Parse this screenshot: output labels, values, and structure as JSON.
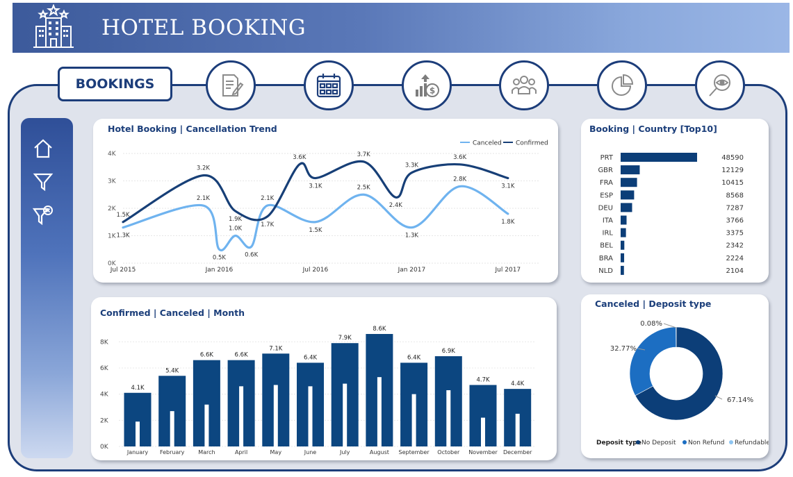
{
  "header": {
    "title": "HOTEL BOOKING"
  },
  "nav": {
    "active_tab": "BOOKINGS"
  },
  "trend": {
    "title": "Hotel Booking | Cancellation Trend",
    "legend": [
      {
        "label": "Canceled",
        "color": "#6fb3ef"
      },
      {
        "label": "Confirmed",
        "color": "#173f77"
      }
    ],
    "y_ticks": [
      "0K",
      "1K",
      "2K",
      "3K",
      "4K"
    ],
    "x_ticks": [
      "Jul 2015",
      "Jan 2016",
      "Jul 2016",
      "Jan 2017",
      "Jul 2017"
    ],
    "confirmed_labels": [
      "1.5K",
      "3.2K",
      "1.9K",
      "1.7K",
      "3.6K",
      "3.1K",
      "3.7K",
      "2.4K",
      "3.3K",
      "3.6K",
      "3.1K"
    ],
    "canceled_labels": [
      "1.3K",
      "2.1K",
      "0.5K",
      "1.0K",
      "0.6K",
      "2.1K",
      "1.5K",
      "2.5K",
      "1.3K",
      "2.8K",
      "1.8K"
    ]
  },
  "country": {
    "title": "Booking | Country [Top10]",
    "rows": [
      {
        "code": "PRT",
        "value": "48590"
      },
      {
        "code": "GBR",
        "value": "12129"
      },
      {
        "code": "FRA",
        "value": "10415"
      },
      {
        "code": "ESP",
        "value": "8568"
      },
      {
        "code": "DEU",
        "value": "7287"
      },
      {
        "code": "ITA",
        "value": "3766"
      },
      {
        "code": "IRL",
        "value": "3375"
      },
      {
        "code": "BEL",
        "value": "2342"
      },
      {
        "code": "BRA",
        "value": "2224"
      },
      {
        "code": "NLD",
        "value": "2104"
      }
    ]
  },
  "monthly": {
    "title": "Confirmed | Canceled | Month",
    "y_ticks": [
      "0K",
      "2K",
      "4K",
      "6K",
      "8K"
    ]
  },
  "deposit": {
    "title": "Canceled | Deposit type",
    "legend_title": "Deposit type",
    "slices": [
      {
        "label": "No Deposit",
        "value_label": "67.14%",
        "color": "#0c3e78"
      },
      {
        "label": "Non Refund",
        "value_label": "32.77%",
        "color": "#1c6ec2"
      },
      {
        "label": "Refundable",
        "value_label": "0.08%",
        "color": "#8ec5f1"
      }
    ]
  },
  "chart_data": [
    {
      "type": "line",
      "title": "Hotel Booking | Cancellation Trend",
      "x": [
        "2015-07",
        "2015-09",
        "2015-11",
        "2016-01",
        "2016-03",
        "2016-05",
        "2016-07",
        "2016-09",
        "2016-11",
        "2017-01",
        "2017-03",
        "2017-05",
        "2017-07",
        "2017-09"
      ],
      "ylim": [
        0,
        4000
      ],
      "series": [
        {
          "name": "Confirmed",
          "x": [
            "2015-07",
            "2015-12",
            "2016-02",
            "2016-04",
            "2016-06",
            "2016-07",
            "2016-10",
            "2016-12",
            "2017-01",
            "2017-04",
            "2017-07"
          ],
          "values": [
            1500,
            3200,
            1900,
            1700,
            3600,
            3100,
            3700,
            2400,
            3300,
            3600,
            3100
          ]
        },
        {
          "name": "Canceled",
          "x": [
            "2015-07",
            "2015-12",
            "2016-01",
            "2016-02",
            "2016-03",
            "2016-04",
            "2016-07",
            "2016-10",
            "2017-01",
            "2017-04",
            "2017-07"
          ],
          "values": [
            1300,
            2100,
            500,
            1000,
            600,
            2100,
            1500,
            2500,
            1300,
            2800,
            1800
          ]
        }
      ],
      "legend": "top-right",
      "grid": true
    },
    {
      "type": "bar",
      "title": "Booking | Country [Top10]",
      "orientation": "horizontal",
      "categories": [
        "PRT",
        "GBR",
        "FRA",
        "ESP",
        "DEU",
        "ITA",
        "IRL",
        "BEL",
        "BRA",
        "NLD"
      ],
      "values": [
        48590,
        12129,
        10415,
        8568,
        7287,
        3766,
        3375,
        2342,
        2224,
        2104
      ]
    },
    {
      "type": "bar",
      "title": "Confirmed | Canceled | Month",
      "categories": [
        "January",
        "February",
        "March",
        "April",
        "May",
        "June",
        "July",
        "August",
        "September",
        "October",
        "November",
        "December"
      ],
      "series": [
        {
          "name": "Confirmed",
          "values": [
            4100,
            5400,
            6600,
            6600,
            7100,
            6400,
            7900,
            8600,
            6400,
            6900,
            4700,
            4400
          ],
          "labels": [
            "4.1K",
            "5.4K",
            "6.6K",
            "6.6K",
            "7.1K",
            "6.4K",
            "7.9K",
            "8.6K",
            "6.4K",
            "6.9K",
            "4.7K",
            "4.4K"
          ]
        },
        {
          "name": "Canceled",
          "values": [
            1900,
            2700,
            3200,
            4600,
            4700,
            4600,
            4800,
            5300,
            4000,
            4300,
            2200,
            2500
          ]
        }
      ],
      "ylim": [
        0,
        8600
      ],
      "grid": true
    },
    {
      "type": "pie",
      "title": "Canceled | Deposit type",
      "categories": [
        "No Deposit",
        "Non Refund",
        "Refundable"
      ],
      "values": [
        67.14,
        32.77,
        0.08
      ],
      "legend": "bottom"
    }
  ]
}
